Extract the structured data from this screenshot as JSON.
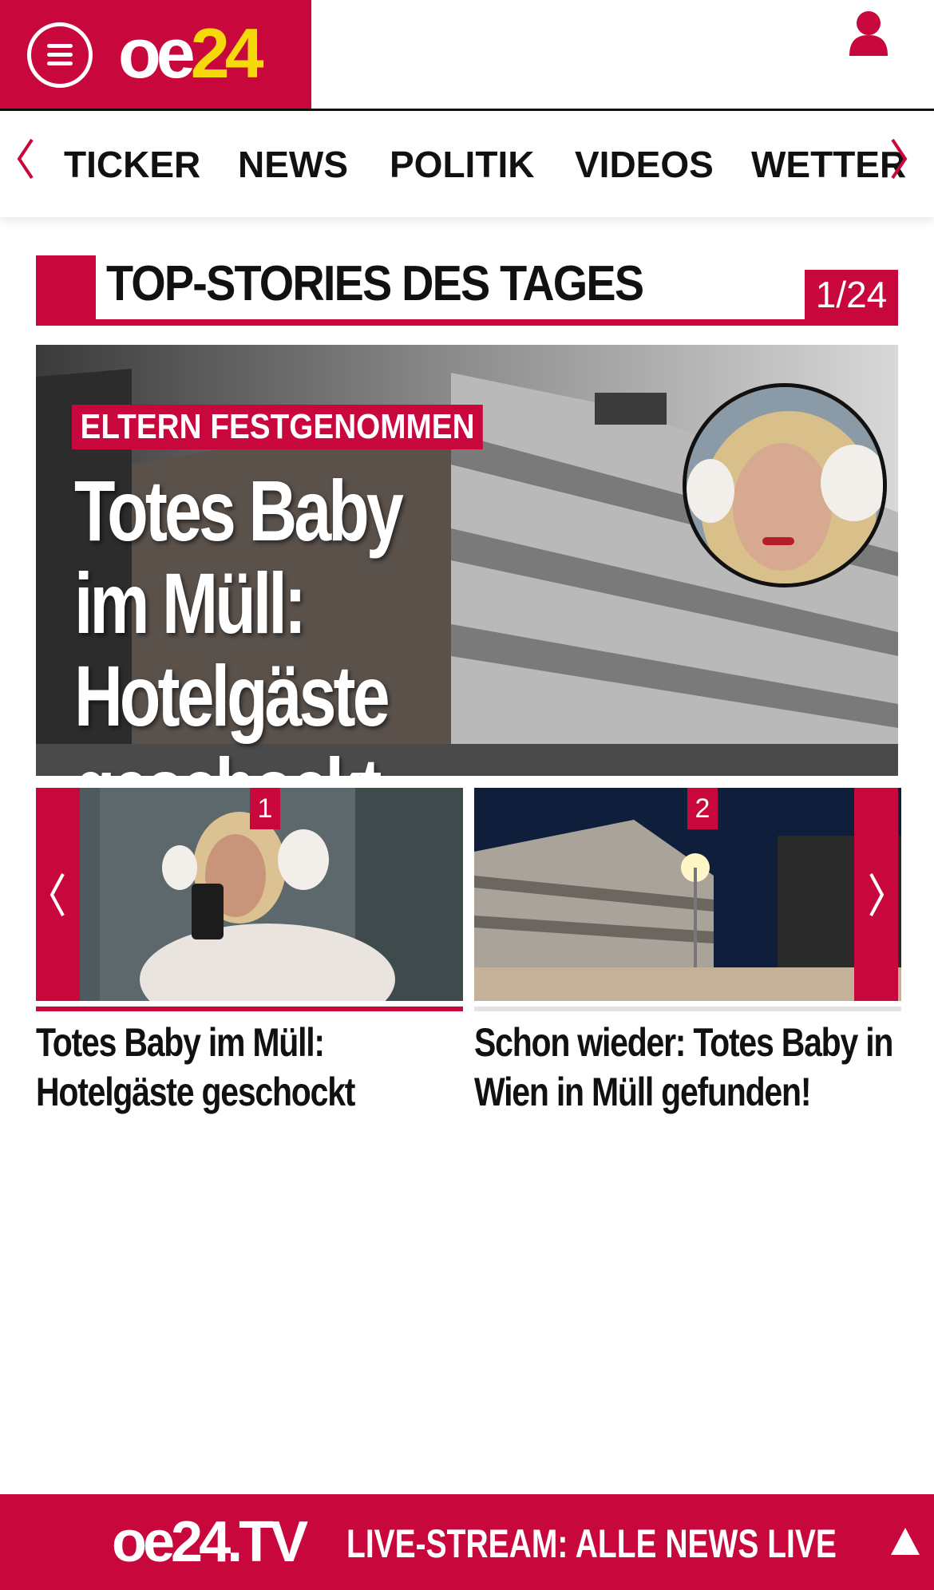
{
  "header": {
    "logo_oe": "oe",
    "logo_num": "24",
    "menu_icon": "hamburger-menu-icon",
    "user_icon": "user-icon"
  },
  "nav": {
    "items": [
      {
        "label": "TICKER"
      },
      {
        "label": "NEWS"
      },
      {
        "label": "POLITIK"
      },
      {
        "label": "VIDEOS"
      },
      {
        "label": "WETTER"
      }
    ],
    "prev_icon": "chevron-left-icon",
    "next_icon": "chevron-right-icon"
  },
  "section": {
    "title": "TOP-STORIES DES TAGES",
    "counter": "1/24"
  },
  "hero": {
    "kicker": "ELTERN FESTGENOMMEN",
    "title_line1": "Totes Baby",
    "title_line2": "im Müll:",
    "title_line3": "Hotelgäste geschockt"
  },
  "teasers": [
    {
      "number": "1",
      "title": "Totes Baby im Müll: Hotelgäste geschockt"
    },
    {
      "number": "2",
      "title": "Schon wieder: Totes Baby in Wien in Müll gefunden!"
    }
  ],
  "live_bar": {
    "logo": "oe24.TV",
    "text": "LIVE-STREAM:  ALLE NEWS LIVE",
    "up_icon": "arrow-up-icon"
  },
  "colors": {
    "brand": "#c8083c",
    "logo_accent": "#f5d90a"
  }
}
